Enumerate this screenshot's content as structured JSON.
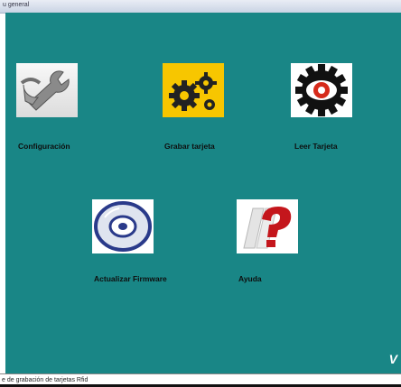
{
  "window": {
    "title": "u general"
  },
  "menu": {
    "items": [
      {
        "label": "Configuración",
        "icon": "wrench-icon"
      },
      {
        "label": "Grabar tarjeta",
        "icon": "gears-icon"
      },
      {
        "label": "Leer Tarjeta",
        "icon": "eye-gear-icon"
      },
      {
        "label": "Actualizar Firmware",
        "icon": "cd-disc-icon"
      },
      {
        "label": "Ayuda",
        "icon": "question-mark-icon"
      }
    ]
  },
  "corner_text": "V",
  "status": {
    "text": "e de grabación de tarjetas Rfid"
  },
  "colors": {
    "background": "#198686",
    "label": "#0e0e0e"
  }
}
